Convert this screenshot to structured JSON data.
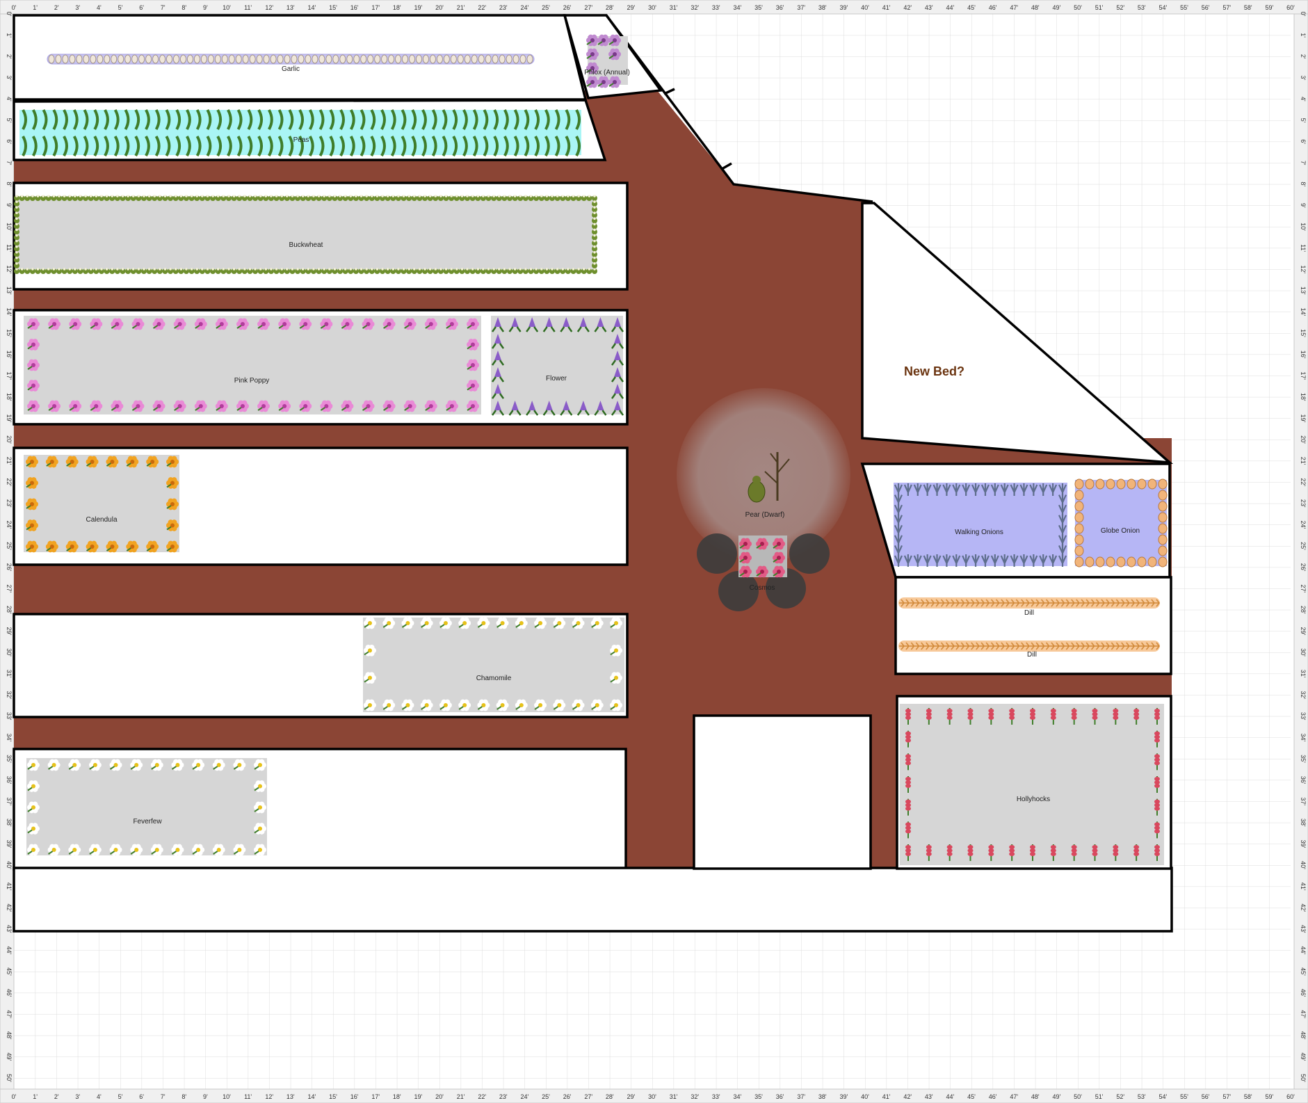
{
  "ruler": {
    "top_labels": [
      "0'",
      "1'",
      "2'",
      "3'",
      "4'",
      "5'",
      "6'",
      "7'",
      "8'",
      "9'",
      "10'",
      "11'",
      "12'",
      "13'",
      "14'",
      "15'",
      "16'",
      "17'",
      "18'",
      "19'",
      "20'",
      "21'",
      "22'",
      "23'",
      "24'",
      "25'",
      "26'",
      "27'",
      "28'",
      "29'",
      "30'",
      "31'",
      "32'",
      "33'",
      "34'",
      "35'",
      "36'",
      "37'",
      "38'",
      "39'",
      "40'",
      "41'",
      "42'",
      "43'",
      "44'",
      "45'",
      "46'",
      "47'",
      "48'",
      "49'",
      "50'",
      "51'",
      "52'",
      "53'",
      "54'",
      "55'",
      "56'",
      "57'",
      "58'",
      "59'",
      "60'"
    ],
    "side_labels": [
      "0'",
      "1'",
      "2'",
      "3'",
      "4'",
      "5'",
      "6'",
      "7'",
      "8'",
      "9'",
      "10'",
      "11'",
      "12'",
      "13'",
      "14'",
      "15'",
      "16'",
      "17'",
      "18'",
      "19'",
      "20'",
      "21'",
      "22'",
      "23'",
      "24'",
      "25'",
      "26'",
      "27'",
      "28'",
      "29'",
      "30'",
      "31'",
      "32'",
      "33'",
      "34'",
      "35'",
      "36'",
      "37'",
      "38'",
      "39'",
      "40'",
      "41'",
      "42'",
      "43'",
      "44'",
      "45'",
      "46'",
      "47'",
      "48'",
      "49'",
      "50'"
    ]
  },
  "colors": {
    "path": "#8b4535",
    "grid": "#dcdcdc",
    "bed_fill": "#d6d6d6",
    "water_fill": "#a9f5f5",
    "onion_fill": "#b6b6f5",
    "canopy": "#a58a86",
    "shade": "#3c3c3c",
    "note": "#6b3410"
  },
  "plantings": {
    "garlic": "Garlic",
    "phlox": "Phlox (Annual)",
    "peas": "Peas",
    "buckwheat": "Buckwheat",
    "pink_poppy": "Pink Poppy",
    "flower": "Flower",
    "calendula": "Calendula",
    "chamomile": "Chamomile",
    "feverfew": "Feverfew",
    "pear": "Pear (Dwarf)",
    "cosmos": "Cosmos",
    "walking_onions": "Walking Onions",
    "globe_onion": "Globe Onion",
    "dill_1": "Dill",
    "dill_2": "Dill",
    "hollyhocks": "Hollyhocks"
  },
  "note": "New Bed?",
  "icons": [
    "garlic-icon",
    "pea-pod-icon",
    "buckwheat-icon",
    "pink-poppy-icon",
    "purple-flower-icon",
    "calendula-icon",
    "daisy-icon",
    "pear-tree-icon",
    "cosmos-icon",
    "onion-icon",
    "dill-icon",
    "hollyhock-icon"
  ]
}
